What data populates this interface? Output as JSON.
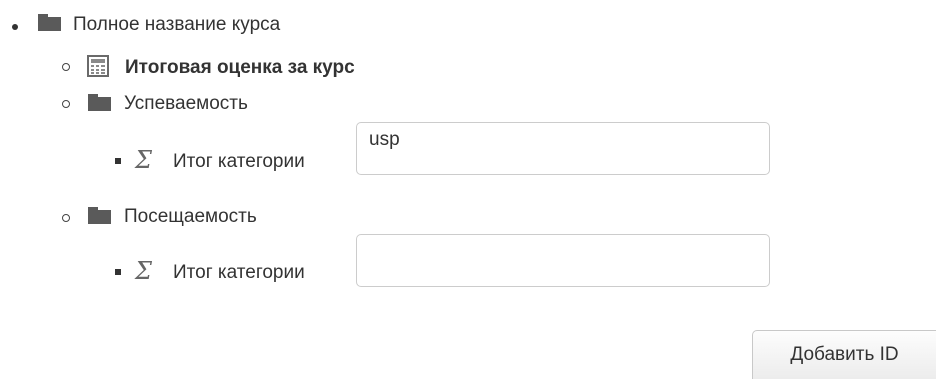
{
  "tree": {
    "course": {
      "label": "Полное название курса",
      "icon": "folder-icon"
    },
    "course_total": {
      "label": "Итоговая оценка за курс",
      "icon": "calculator-icon"
    },
    "category_1": {
      "label": "Успеваемость",
      "icon": "folder-icon",
      "total": {
        "label": "Итог категории",
        "icon": "sigma-icon",
        "input_value": "usp"
      }
    },
    "category_2": {
      "label": "Посещаемость",
      "icon": "folder-icon",
      "total": {
        "label": "Итог категории",
        "icon": "sigma-icon",
        "input_value": ""
      }
    }
  },
  "actions": {
    "add_id_label": "Добавить ID"
  },
  "colors": {
    "text": "#333333",
    "icon": "#5a5a5a",
    "border": "#cccccc"
  }
}
